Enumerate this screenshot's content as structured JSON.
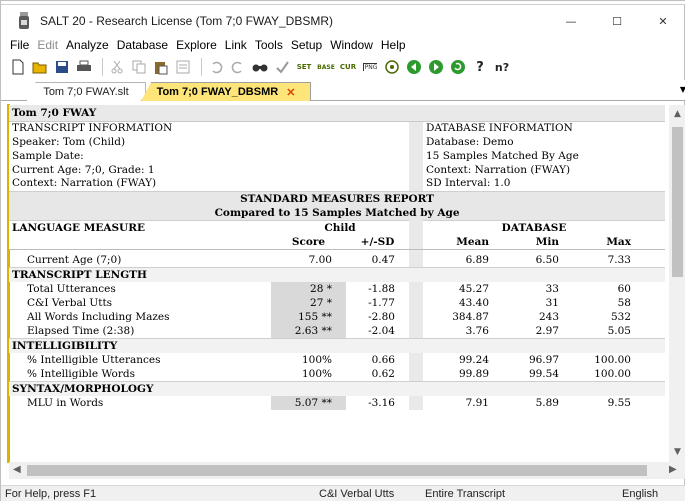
{
  "window": {
    "title": "SALT 20 - Research License (Tom 7;0 FWAY_DBSMR)",
    "minimize_glyph": "—",
    "maximize_glyph": "☐",
    "close_glyph": "✕"
  },
  "menu": {
    "items": [
      "File",
      "Edit",
      "Analyze",
      "Database",
      "Explore",
      "Link",
      "Tools",
      "Setup",
      "Window",
      "Help"
    ],
    "disabled": [
      "Edit"
    ]
  },
  "toolbar": {
    "icons": [
      "new-icon",
      "open-icon",
      "save-icon",
      "print-icon",
      "cut-icon",
      "copy-icon",
      "paste-icon",
      "view-icon",
      "undo-icon",
      "redo-icon",
      "find-icon",
      "check-icon",
      "set-icon",
      "base-icon",
      "curr-icon",
      "png-icon",
      "link-icon",
      "back-icon",
      "forward-icon",
      "refresh-icon",
      "help-icon",
      "context-help-icon"
    ],
    "labels": {
      "set": "SET",
      "base": "BASE",
      "curr": "CUR",
      "png": "PNG",
      "help": "?",
      "context_help": "n?"
    }
  },
  "tabs": [
    {
      "label": "Tom 7;0 FWAY.slt",
      "active": false
    },
    {
      "label": "Tom 7;0 FWAY_DBSMR",
      "active": true,
      "close": "✕"
    }
  ],
  "report": {
    "header_title": "Tom 7;0 FWAY",
    "transcript_info": {
      "heading": "TRANSCRIPT INFORMATION",
      "lines": [
        "Speaker: Tom (Child)",
        "Sample Date:",
        "Current Age: 7;0, Grade: 1",
        "Context: Narration (FWAY)"
      ]
    },
    "database_info": {
      "heading": "DATABASE INFORMATION",
      "lines": [
        "Database: Demo",
        "15 Samples Matched By Age",
        "Context: Narration (FWAY)",
        "SD Interval: 1.0"
      ]
    },
    "report_title": "STANDARD MEASURES REPORT",
    "report_subtitle": "Compared to 15 Samples Matched by Age",
    "col_measure": "LANGUAGE MEASURE",
    "col_child": "Child",
    "col_database": "DATABASE",
    "col_score": "Score",
    "col_sd": "+/-SD",
    "col_mean": "Mean",
    "col_min": "Min",
    "col_max": "Max",
    "current_age": {
      "label": "Current Age (7;0)",
      "score": "7.00",
      "sd": "0.47",
      "mean": "6.89",
      "min": "6.50",
      "max": "7.33"
    },
    "sections": [
      {
        "name": "TRANSCRIPT LENGTH",
        "rows": [
          {
            "label": "Total Utterances",
            "score": "28 *",
            "sd": "-1.88",
            "mean": "45.27",
            "min": "33",
            "max": "60",
            "shade": true
          },
          {
            "label": "C&I Verbal Utts",
            "score": "27 *",
            "sd": "-1.77",
            "mean": "43.40",
            "min": "31",
            "max": "58",
            "shade": true
          },
          {
            "label": "All Words Including Mazes",
            "score": "155 **",
            "sd": "-2.80",
            "mean": "384.87",
            "min": "243",
            "max": "532",
            "shade": true
          },
          {
            "label": "Elapsed Time (2:38)",
            "score": "2.63 **",
            "sd": "-2.04",
            "mean": "3.76",
            "min": "2.97",
            "max": "5.05",
            "shade": true
          }
        ]
      },
      {
        "name": "INTELLIGIBILITY",
        "rows": [
          {
            "label": "% Intelligible Utterances",
            "score": "100%",
            "sd": "0.66",
            "mean": "99.24",
            "min": "96.97",
            "max": "100.00",
            "shade": false
          },
          {
            "label": "% Intelligible Words",
            "score": "100%",
            "sd": "0.62",
            "mean": "99.89",
            "min": "99.54",
            "max": "100.00",
            "shade": false
          }
        ]
      },
      {
        "name": "SYNTAX/MORPHOLOGY",
        "rows": [
          {
            "label": "MLU in Words",
            "score": "5.07 **",
            "sd": "-3.16",
            "mean": "7.91",
            "min": "5.89",
            "max": "9.55",
            "shade": true
          }
        ]
      }
    ]
  },
  "status": {
    "help": "For Help, press F1",
    "utts": "C&I Verbal Utts",
    "scope": "Entire Transcript",
    "language": "English"
  },
  "colors": {
    "active_tab": "#fde57a",
    "doc_accent": "#d8b400",
    "close_x": "#d04a00"
  }
}
